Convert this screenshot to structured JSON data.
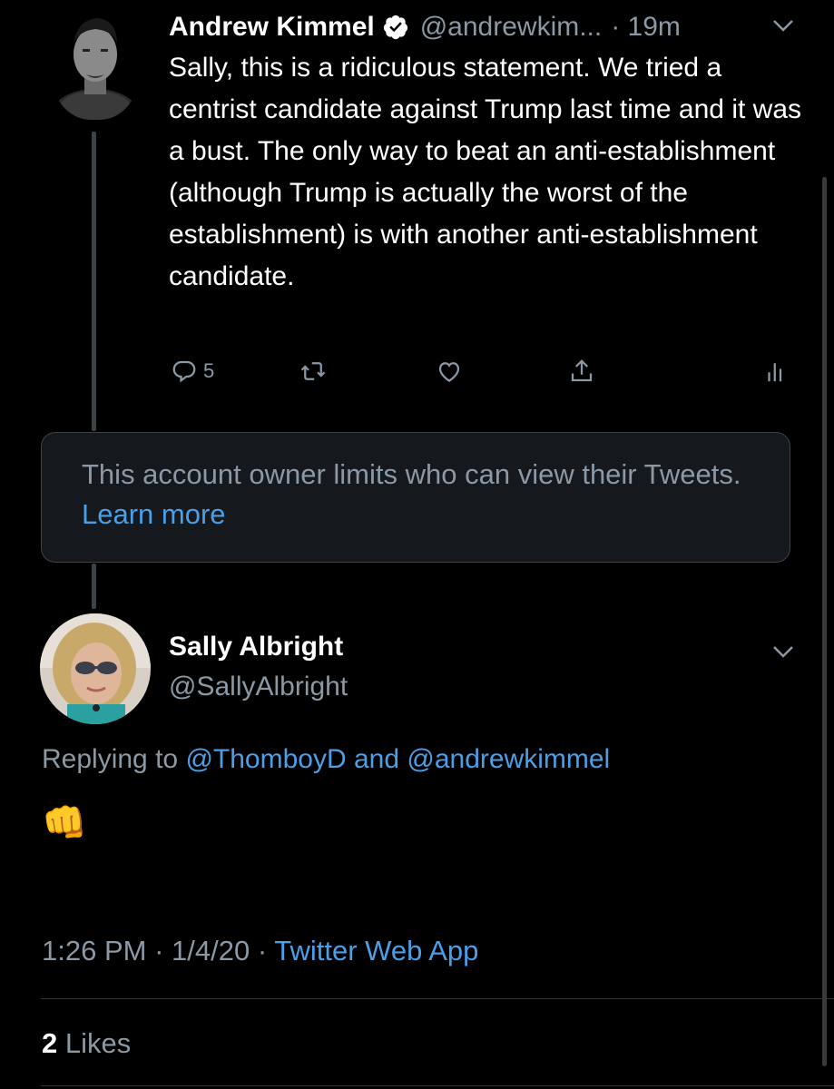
{
  "tweet1": {
    "author_name": "Andrew Kimmel",
    "author_handle": "@andrewkim...",
    "time": "· 19m",
    "text": "Sally, this is a ridiculous statement. We tried a centrist candidate against Trump last time and it was a bust. The only way to beat an anti-establishment (although Trump is actually the worst of the establishment) is with another anti-establishment candidate.",
    "reply_count": "5"
  },
  "notice": {
    "text": "This account owner limits who can view their Tweets.",
    "link": "Learn more"
  },
  "tweet2": {
    "author_name": "Sally Albright",
    "author_handle": "@SallyAlbright",
    "replying_prefix": "Replying to",
    "replying_user1": "@ThomboyD",
    "replying_and": "and",
    "replying_user2": "@andrewkimmel",
    "body_emoji": "👊",
    "time": "1:26 PM",
    "date": "1/4/20",
    "sep": "·",
    "source": "Twitter Web App",
    "likes_count": "2",
    "likes_label": "Likes"
  },
  "colors": {
    "background": "#000000",
    "secondary_text": "#8b98a5",
    "link": "#4a9fe8",
    "verified_badge": "#ffffff"
  },
  "icons": [
    "verified-icon",
    "chevron-down-icon",
    "reply-icon",
    "retweet-icon",
    "like-icon",
    "share-icon",
    "analytics-icon"
  ]
}
